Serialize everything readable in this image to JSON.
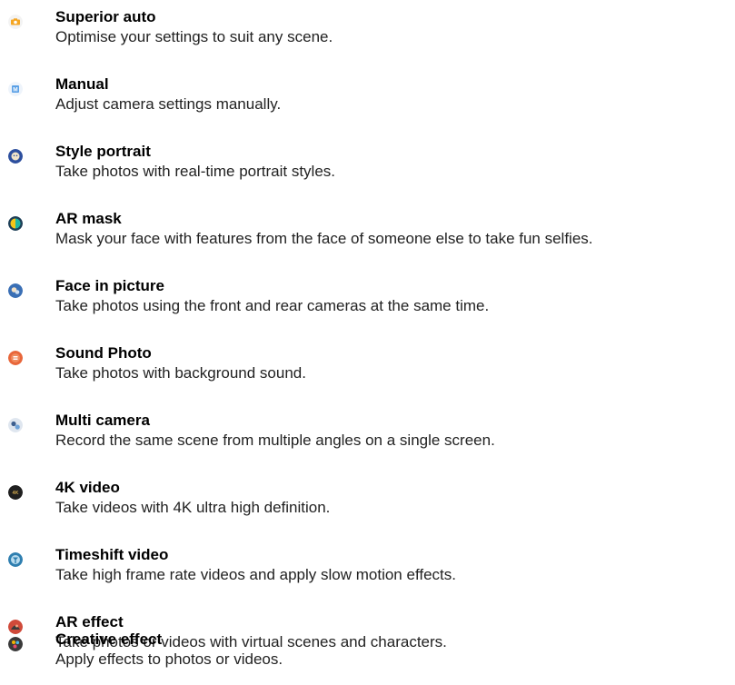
{
  "modes": [
    {
      "icon": "superior-auto-icon",
      "title": "Superior auto",
      "description": "Optimise your settings to suit any scene."
    },
    {
      "icon": "manual-icon",
      "title": "Manual",
      "description": "Adjust camera settings manually."
    },
    {
      "icon": "style-portrait-icon",
      "title": "Style portrait",
      "description": "Take photos with real-time portrait styles."
    },
    {
      "icon": "ar-mask-icon",
      "title": "AR mask",
      "description": "Mask your face with features from the face of someone else to take fun selfies."
    },
    {
      "icon": "face-in-picture-icon",
      "title": "Face in picture",
      "description": "Take photos using the front and rear cameras at the same time."
    },
    {
      "icon": "sound-photo-icon",
      "title": "Sound Photo",
      "description": "Take photos with background sound."
    },
    {
      "icon": "multi-camera-icon",
      "title": "Multi camera",
      "description": "Record the same scene from multiple angles on a single screen."
    },
    {
      "icon": "4k-video-icon",
      "title": "4K video",
      "description": "Take videos with 4K ultra high definition."
    },
    {
      "icon": "timeshift-video-icon",
      "title": "Timeshift video",
      "description": "Take high frame rate videos and apply slow motion effects."
    },
    {
      "icon": "ar-effect-icon",
      "title": "AR effect",
      "description": "Take photos or videos with virtual scenes and characters."
    },
    {
      "icon": "creative-effect-icon",
      "title": "Creative effect",
      "description": "Apply effects to photos or videos."
    }
  ]
}
